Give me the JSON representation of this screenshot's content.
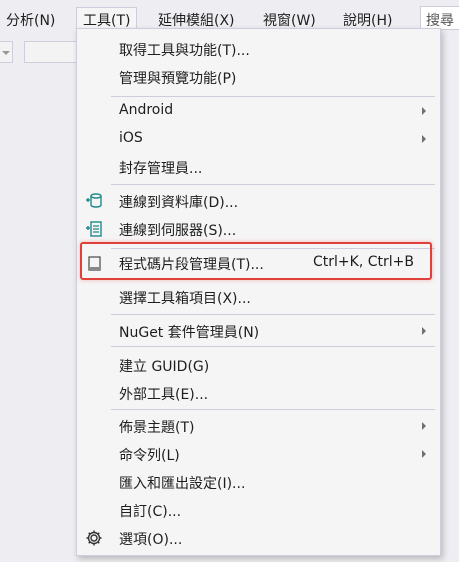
{
  "menubar": {
    "items": [
      "分析(N)",
      "工具(T)",
      "延伸模組(X)",
      "視窗(W)",
      "說明(H)"
    ],
    "search_label": "搜尋"
  },
  "menu": {
    "items": [
      {
        "label": "取得工具與功能(T)..."
      },
      {
        "label": "管理與預覽功能(P)"
      },
      {
        "label": "Android"
      },
      {
        "label": "iOS"
      },
      {
        "label": "封存管理員..."
      },
      {
        "label": "連線到資料庫(D)..."
      },
      {
        "label": "連線到伺服器(S)..."
      },
      {
        "label": "程式碼片段管理員(T)...",
        "shortcut": "Ctrl+K, Ctrl+B"
      },
      {
        "label": "選擇工具箱項目(X)..."
      },
      {
        "label": "NuGet 套件管理員(N)"
      },
      {
        "label": "建立 GUID(G)"
      },
      {
        "label": "外部工具(E)..."
      },
      {
        "label": "佈景主題(T)"
      },
      {
        "label": "命令列(L)"
      },
      {
        "label": "匯入和匯出設定(I)..."
      },
      {
        "label": "自訂(C)..."
      },
      {
        "label": "選項(O)..."
      }
    ]
  },
  "colors": {
    "highlight_border": "#e0403a",
    "icon_teal": "#1f8a8a",
    "menu_bg": "#f5f5f5"
  },
  "icons": {
    "connect_database": "database-plug-icon",
    "connect_server": "server-plug-icon",
    "snippets": "code-snippet-icon",
    "options": "gear-icon"
  }
}
